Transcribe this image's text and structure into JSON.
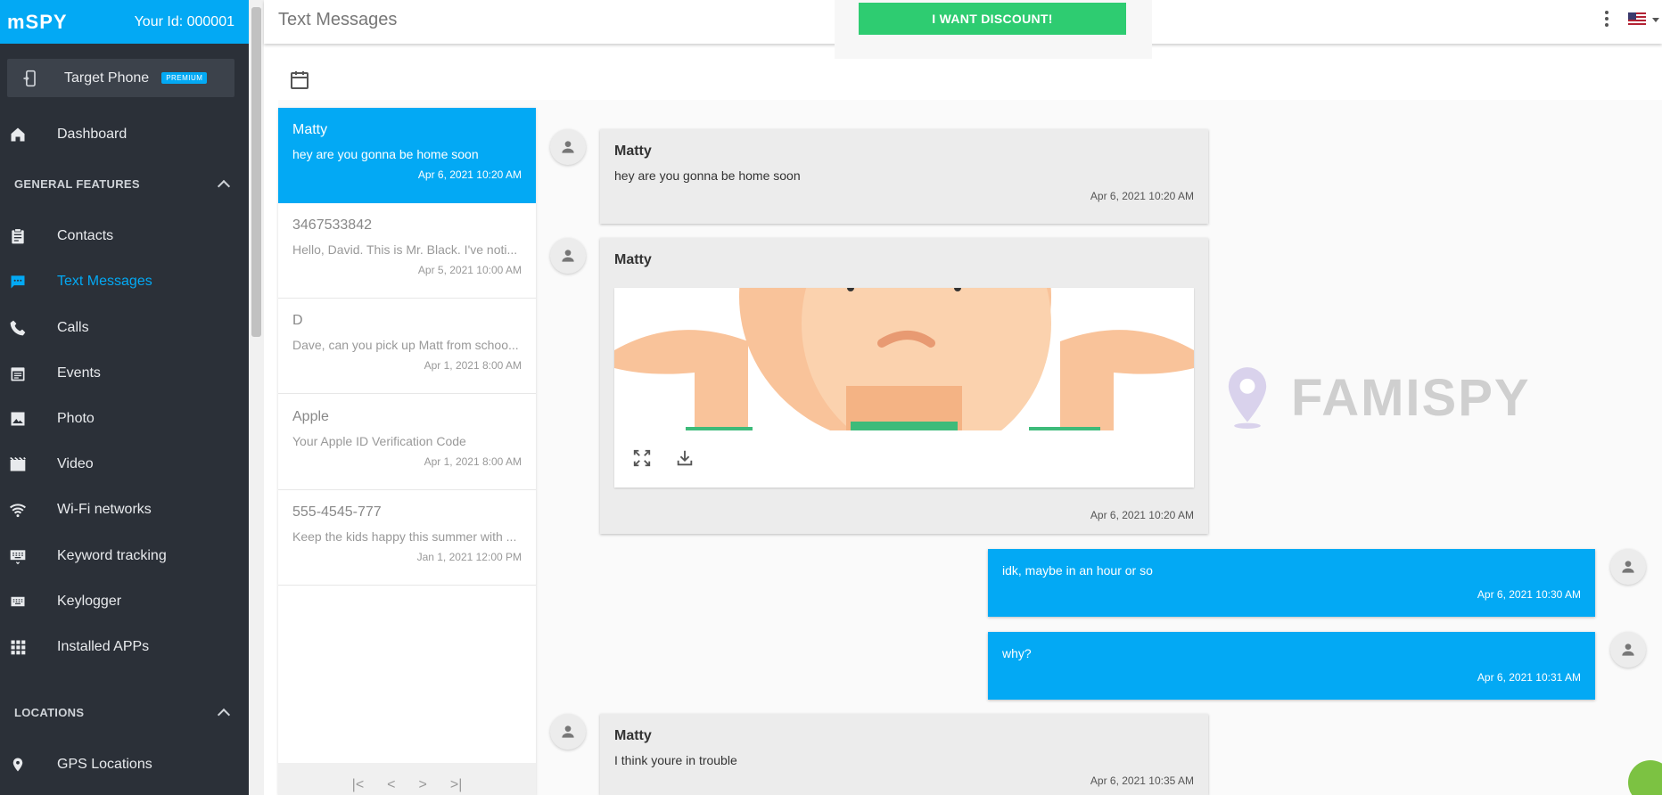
{
  "brand": {
    "logo": "mSPY",
    "user_id": "Your Id: 000001"
  },
  "target": {
    "label": "Target Phone",
    "badge": "PREMIUM"
  },
  "nav": {
    "dashboard": "Dashboard",
    "section_general": "GENERAL FEATURES",
    "items": [
      "Contacts",
      "Text Messages",
      "Calls",
      "Events",
      "Photo",
      "Video",
      "Wi-Fi networks",
      "Keyword tracking",
      "Keylogger",
      "Installed APPs"
    ],
    "active": "Text Messages",
    "section_locations": "LOCATIONS",
    "gps": "GPS Locations"
  },
  "header": {
    "title": "Text Messages",
    "discount_button": "I WANT DISCOUNT!"
  },
  "conversations": [
    {
      "name": "Matty",
      "preview": "hey are you gonna be home soon",
      "time": "Apr 6, 2021 10:20 AM",
      "active": true
    },
    {
      "name": "3467533842",
      "preview": "Hello, David. This is Mr. Black. I've noti...",
      "time": "Apr 5, 2021 10:00 AM"
    },
    {
      "name": "D",
      "preview": "Dave, can you pick up Matt from schoo...",
      "time": "Apr 1, 2021 8:00 AM"
    },
    {
      "name": "Apple",
      "preview": "Your Apple ID Verification Code",
      "time": "Apr 1, 2021 8:00 AM"
    },
    {
      "name": "555-4545-777",
      "preview": "Keep the kids happy this summer with ...",
      "time": "Jan 1, 2021 12:00 PM"
    }
  ],
  "pager": {
    "first": "|<",
    "prev": "<",
    "next": ">",
    "last": ">|"
  },
  "messages": [
    {
      "dir": "in",
      "name": "Matty",
      "text": "hey are you gonna be home soon",
      "time": "Apr 6, 2021 10:20 AM"
    },
    {
      "dir": "in",
      "name": "Matty",
      "text": "",
      "has_image": true,
      "time": "Apr 6, 2021 10:20 AM"
    },
    {
      "dir": "out",
      "text": "idk, maybe in an hour or so",
      "time": "Apr 6, 2021 10:30 AM"
    },
    {
      "dir": "out",
      "text": "why?",
      "time": "Apr 6, 2021 10:31 AM"
    },
    {
      "dir": "in",
      "name": "Matty",
      "text": "I think youre in trouble",
      "time": "Apr 6, 2021 10:35 AM"
    }
  ],
  "watermark": "FAMISPY",
  "colors": {
    "accent": "#03a9f4",
    "sidebar": "#2b3038",
    "discount": "#2ecc71"
  },
  "icons": [
    "phone-sync-icon",
    "home-icon",
    "clipboard-icon",
    "chat-icon",
    "phone-icon",
    "calendar-icon",
    "image-icon",
    "video-icon",
    "wifi-icon",
    "keyboard-icon",
    "apps-grid-icon",
    "location-pin-icon",
    "person-icon",
    "fullscreen-icon",
    "download-icon",
    "kebab-icon",
    "us-flag-icon"
  ]
}
